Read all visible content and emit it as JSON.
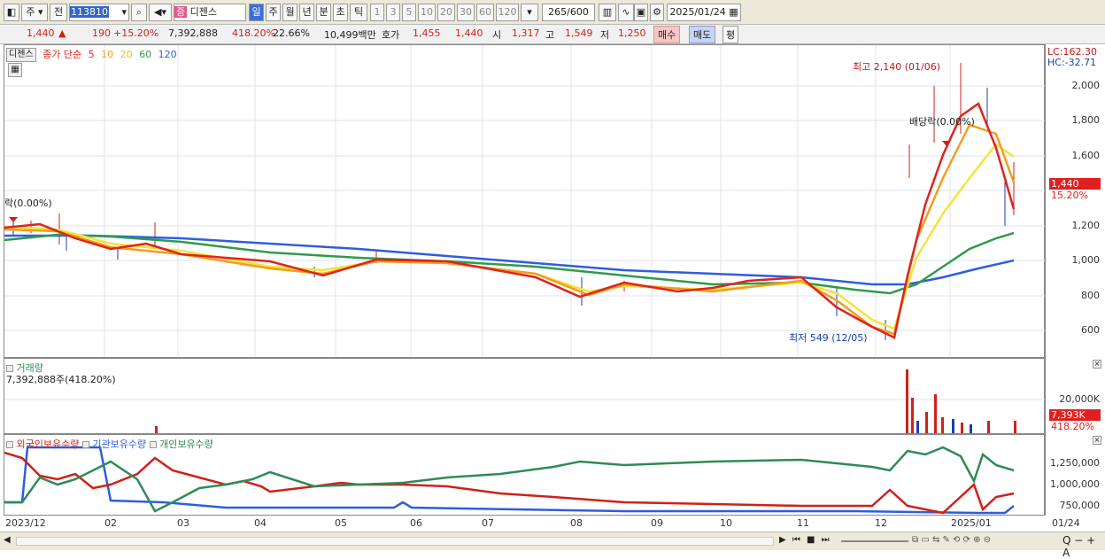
{
  "toolbar": {
    "mode": "주",
    "prev_label": "전",
    "code": "113810",
    "stock_name": "디젠스",
    "badge": "증",
    "periods": [
      "일",
      "주",
      "월",
      "년",
      "분",
      "초",
      "틱"
    ],
    "intervals": [
      "1",
      "3",
      "5",
      "10",
      "20",
      "30",
      "60",
      "120"
    ],
    "count": "265",
    "count_total": "/600",
    "date": "2025/01/24"
  },
  "status": {
    "price": "1,440",
    "arrow": "▲",
    "change": "190",
    "change_pct": "+15.20%",
    "volume": "7,392,888",
    "volume_pct": "418.20%",
    "turnover_pct": "22.66%",
    "amount": "10,499백만",
    "hoga_label": "호가",
    "hoga_ask": "1,455",
    "hoga_bid": "1,440",
    "open_label": "시",
    "open": "1,317",
    "high_label": "고",
    "high": "1,549",
    "low_label": "저",
    "low": "1,250",
    "buy_label": "매수",
    "sell_label": "매도",
    "eval_label": "평"
  },
  "price_pane": {
    "name": "디젠스",
    "ma_label": "종가 단순",
    "ma_periods": [
      "5",
      "10",
      "20",
      "60",
      "120"
    ],
    "ma_colors": [
      "#e0241b",
      "#f39c1f",
      "#f4e43a",
      "#2e9b4b",
      "#2f5ddf"
    ],
    "lc": "LC:162.30",
    "hc": "HC:-32.71",
    "high_note": "최고 2,140 (01/06)",
    "low_note": "최저 549 (12/05)",
    "dividend_note": "배당락(0.00%)",
    "left_note": "락(0.00%)",
    "current_tag": "1,440",
    "current_pct": "15.20%",
    "y_ticks": [
      "2,000",
      "1,800",
      "1,600",
      "1,400",
      "1,200",
      "1,000",
      "800",
      "600"
    ]
  },
  "volume_pane": {
    "title": "거래량",
    "value": "7,392,888주(418.20%)",
    "y_tick": "20,000K",
    "tag": "7,393K",
    "tag_pct": "418.20%"
  },
  "holding_pane": {
    "legend": [
      {
        "label": "외국인보유수량",
        "color": "#d0201a"
      },
      {
        "label": "기관보유수량",
        "color": "#2f5ddf"
      },
      {
        "label": "개인보유수량",
        "color": "#2e8b57"
      }
    ],
    "y_ticks": [
      "1,250,000",
      "1,000,000",
      "750,000"
    ]
  },
  "x_axis": [
    "2023/12",
    "02",
    "03",
    "04",
    "05",
    "06",
    "07",
    "08",
    "09",
    "10",
    "11",
    "12",
    "2025/01",
    "01/24"
  ],
  "chart_data": {
    "type": "line",
    "title": "",
    "xlabel": "",
    "ylabel": "",
    "ylim": [
      500,
      2150
    ],
    "x": [
      "2023/12",
      "2024/02",
      "2024/03",
      "2024/04",
      "2024/05",
      "2024/06",
      "2024/07",
      "2024/08",
      "2024/09",
      "2024/10",
      "2024/11",
      "2024/12",
      "2025/01",
      "2025/01/24"
    ],
    "series": [
      {
        "name": "종가 단순 5",
        "values": [
          1180,
          1120,
          1080,
          1050,
          960,
          1000,
          980,
          880,
          830,
          850,
          900,
          570,
          1900,
          1440
        ]
      },
      {
        "name": "종가 단순 120",
        "values": [
          1140,
          1150,
          1120,
          1090,
          1060,
          1020,
          990,
          960,
          940,
          920,
          905,
          850,
          960,
          1000
        ]
      }
    ]
  }
}
